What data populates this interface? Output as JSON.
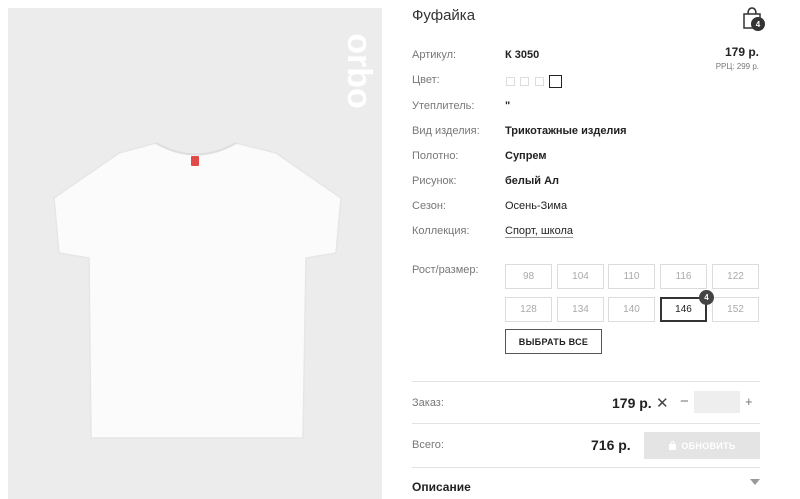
{
  "product": {
    "title": "Фуфайка",
    "cart_count": "4",
    "price": "179 р.",
    "rrp": "РРЦ: 299 р.",
    "logo_text": "orbo"
  },
  "specs": [
    {
      "label": "Артикул:",
      "value": "К 3050"
    },
    {
      "label": "Цвет:",
      "value": ""
    },
    {
      "label": "Утеплитель:",
      "value": "\""
    },
    {
      "label": "Вид изделия:",
      "value": "Трикотажные изделия"
    },
    {
      "label": "Полотно:",
      "value": "Супрем"
    },
    {
      "label": "Рисунок:",
      "value": "белый Ал"
    },
    {
      "label": "Сезон:",
      "value": "Осень-Зима"
    },
    {
      "label": "Коллекция:",
      "value": "Спорт, школа"
    }
  ],
  "sizes": {
    "label": "Рост/размер:",
    "items": [
      "98",
      "104",
      "110",
      "116",
      "122",
      "128",
      "134",
      "140",
      "146",
      "152"
    ],
    "selected": "146",
    "selected_count": "4",
    "select_all_label": "ВЫБРАТЬ ВСЕ"
  },
  "order": {
    "label": "Заказ:",
    "price": "179 р.",
    "remove_symbol": "✕",
    "minus": "−",
    "plus": "+",
    "quantity": ""
  },
  "total": {
    "label": "Всего:",
    "price": "716 р.",
    "update_label": "ОБНОВИТЬ"
  },
  "description": {
    "label": "Описание"
  },
  "colors": {
    "badge": "#333333",
    "update_button_bg": "#e4e4e4",
    "photo_bg": "#ececed"
  }
}
